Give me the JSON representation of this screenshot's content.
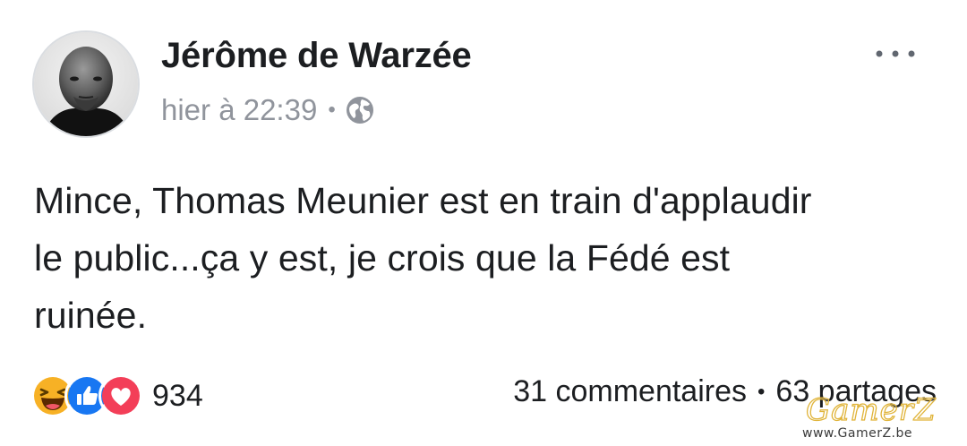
{
  "post": {
    "author": "Jérôme de Warzée",
    "timestamp": "hier à 22:39",
    "meta_separator": "•",
    "audience_icon": "globe-icon",
    "menu_icon": "more-horizontal-icon",
    "text": "Mince, Thomas Meunier est en train d'applaudir\nle public...ça y est, je crois que la Fédé est\nruinée."
  },
  "reactions": {
    "icons": [
      "haha-icon",
      "like-icon",
      "love-icon"
    ],
    "count": "934"
  },
  "stats": {
    "comments": "31 commentaires",
    "separator": "•",
    "shares": "63 partages"
  },
  "watermark": {
    "logo": "GamerZ",
    "url": "www.GamerZ.be"
  },
  "colors": {
    "text": "#1c1e21",
    "meta": "#90949c",
    "like_blue": "#1877f2",
    "love_red": "#f33e58",
    "haha_yellow": "#f7b125"
  }
}
